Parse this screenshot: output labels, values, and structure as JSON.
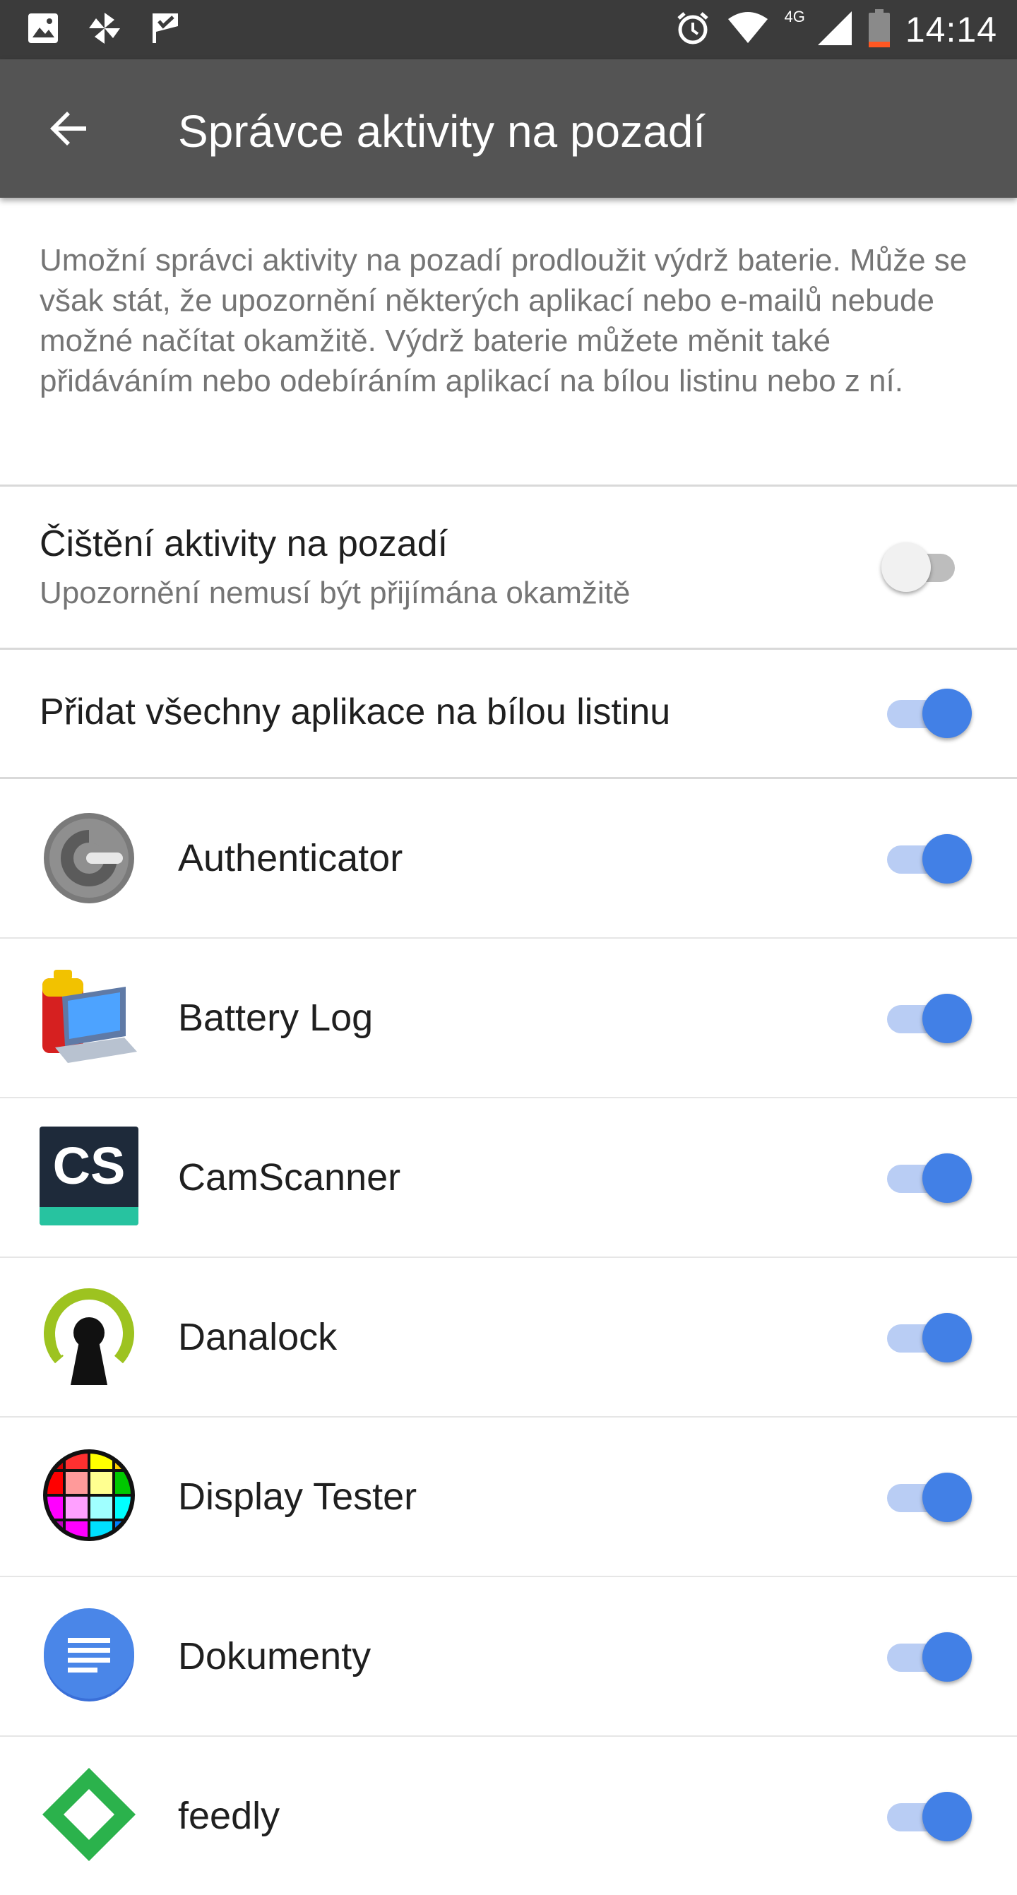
{
  "status_bar": {
    "time": "14:14",
    "network_type": "4G",
    "left_icons": [
      "image-icon",
      "pinwheel-icon",
      "check-flag-icon"
    ],
    "right_icons": [
      "alarm-icon",
      "wifi-icon",
      "cell-signal-icon",
      "battery-low-icon"
    ]
  },
  "app_bar": {
    "title": "Správce aktivity na pozadí",
    "back_icon": "arrow-left-icon"
  },
  "description": "Umožní správci aktivity na pozadí prodloužit výdrž baterie. Může se však stát, že upozornění některých aplikací nebo e-mailů nebude možné načítat okamžitě. Výdrž baterie můžete měnit také přidáváním nebo odebíráním aplikací na bílou listinu nebo z ní.",
  "settings": {
    "cleanup": {
      "title": "Čištění aktivity na pozadí",
      "subtitle": "Upozornění nemusí být přijímána okamžitě",
      "enabled": false
    },
    "whitelist_all": {
      "title": "Přidat všechny aplikace na bílou listinu",
      "enabled": true
    }
  },
  "apps": [
    {
      "name": "Authenticator",
      "icon": "authenticator-icon",
      "enabled": true
    },
    {
      "name": "Battery Log",
      "icon": "battery-log-icon",
      "enabled": true
    },
    {
      "name": "CamScanner",
      "icon": "camscanner-icon",
      "icon_text": "CS",
      "enabled": true
    },
    {
      "name": "Danalock",
      "icon": "danalock-icon",
      "enabled": true
    },
    {
      "name": "Display Tester",
      "icon": "display-tester-icon",
      "enabled": true
    },
    {
      "name": "Dokumenty",
      "icon": "docs-icon",
      "enabled": true
    },
    {
      "name": "feedly",
      "icon": "feedly-icon",
      "enabled": true
    }
  ],
  "colors": {
    "status_bar": "#3b3b3b",
    "app_bar": "#545454",
    "accent": "#4280e6",
    "accent_track": "#b9cdf4",
    "secondary_text": "#757575"
  }
}
